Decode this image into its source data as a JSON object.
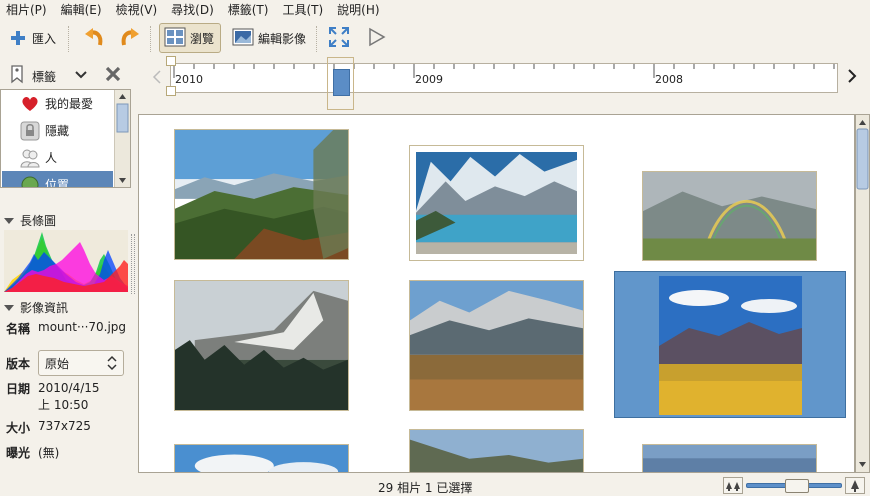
{
  "menu": [
    "相片(P)",
    "編輯(E)",
    "檢視(V)",
    "尋找(D)",
    "標籤(T)",
    "工具(T)",
    "說明(H)"
  ],
  "toolbar": {
    "import_label": "匯入",
    "browse_label": "瀏覽",
    "edit_photo_label": "編輯影像"
  },
  "tags": {
    "label": "標籤",
    "items": [
      "我的最愛",
      "隱藏",
      "人",
      "位置"
    ]
  },
  "histogram": {
    "label": "長條圖"
  },
  "info": {
    "label": "影像資訊",
    "name_key": "名稱",
    "name_val": "mount···70.jpg",
    "version_key": "版本",
    "version_val": "原始",
    "date_key": "日期",
    "date_val1": "2010/4/15",
    "date_val2": "上 10:50",
    "size_key": "大小",
    "size_val": "737x725",
    "exposure_key": "曝光",
    "exposure_val": "(無)"
  },
  "timeline": {
    "years": [
      "2010",
      "2009",
      "2008"
    ]
  },
  "status": {
    "text": "29 相片  1 已選擇"
  },
  "colors": {
    "selection": "#6196cb",
    "accent": "#3f7fc6"
  }
}
